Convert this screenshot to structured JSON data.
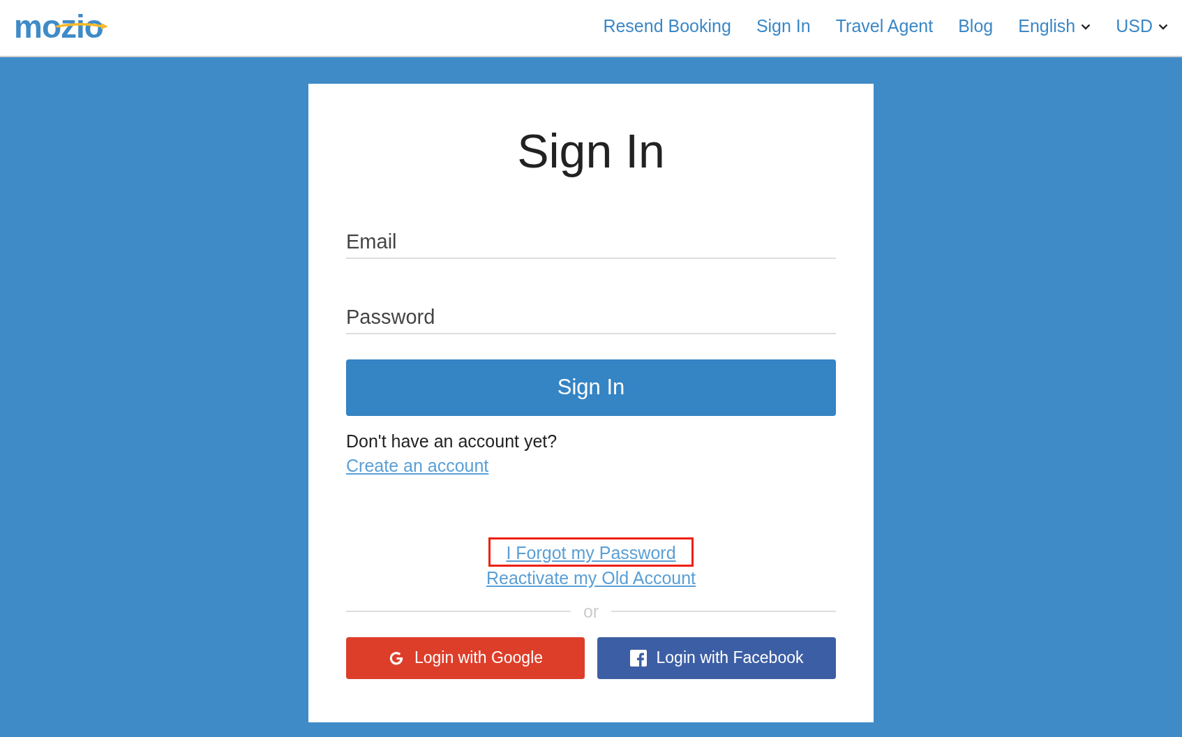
{
  "header": {
    "logo": "mozio",
    "nav": [
      {
        "label": "Resend Booking",
        "kind": "link"
      },
      {
        "label": "Sign In",
        "kind": "link"
      },
      {
        "label": "Travel Agent",
        "kind": "link"
      },
      {
        "label": "Blog",
        "kind": "link"
      },
      {
        "label": "English",
        "kind": "dropdown"
      },
      {
        "label": "USD",
        "kind": "dropdown"
      }
    ]
  },
  "form": {
    "title": "Sign In",
    "fields": [
      {
        "placeholder": "Email"
      },
      {
        "placeholder": "Password"
      }
    ],
    "submit": "Sign In",
    "signup_prompt": "Don't have an account yet?",
    "signup_link": "Create an account",
    "links": [
      {
        "label": "I Forgot my Password",
        "highlighted": true
      },
      {
        "label": "Reactivate my Old Account",
        "highlighted": false
      }
    ],
    "divider": "or",
    "social": [
      {
        "label": "Login with Google",
        "kind": "google"
      },
      {
        "label": "Login with Facebook",
        "kind": "facebook"
      }
    ]
  }
}
